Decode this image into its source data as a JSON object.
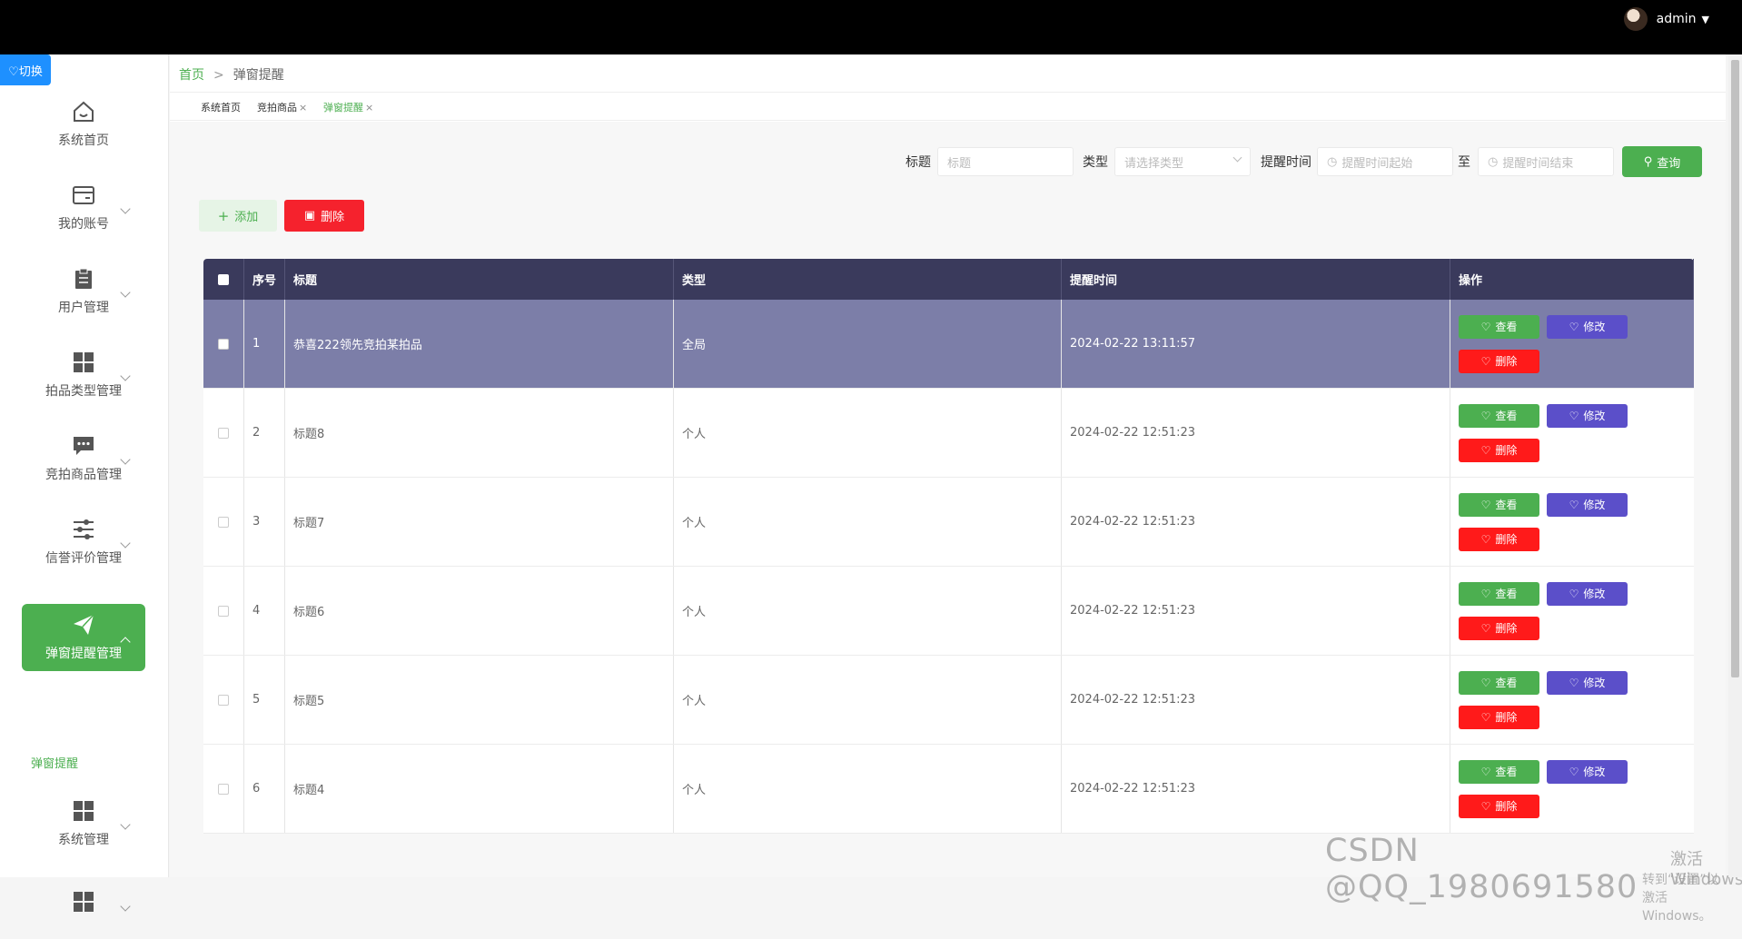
{
  "header": {
    "username": "admin"
  },
  "switch_label": "♡切换",
  "sidebar": {
    "items": [
      {
        "label": "系统首页",
        "icon": "home-icon"
      },
      {
        "label": "我的账号",
        "icon": "wallet-icon"
      },
      {
        "label": "用户管理",
        "icon": "clipboard-icon"
      },
      {
        "label": "拍品类型管理",
        "icon": "grid-icon"
      },
      {
        "label": "竞拍商品管理",
        "icon": "chat-icon"
      },
      {
        "label": "信誉评价管理",
        "icon": "sliders-icon"
      },
      {
        "label": "弹窗提醒管理",
        "icon": "send-icon"
      },
      {
        "label": "系统管理",
        "icon": "grid-icon"
      },
      {
        "label": "",
        "icon": "grid-icon"
      }
    ],
    "sub_item": "弹窗提醒"
  },
  "breadcrumb": {
    "home": "首页",
    "separator": ">",
    "current": "弹窗提醒"
  },
  "tabs": [
    {
      "label": "系统首页",
      "closable": false
    },
    {
      "label": "竞拍商品",
      "closable": true
    },
    {
      "label": "弹窗提醒",
      "closable": true
    }
  ],
  "tab_close": "×",
  "search": {
    "title_label": "标题",
    "title_placeholder": "标题",
    "type_label": "类型",
    "type_placeholder": "请选择类型",
    "time_label": "提醒时间",
    "time_start_placeholder": "提醒时间起始",
    "to_label": "至",
    "time_end_placeholder": "提醒时间结束",
    "query_label": "查询"
  },
  "toolbar": {
    "add_label": "添加",
    "delete_label": "删除"
  },
  "table": {
    "headers": [
      "序号",
      "标题",
      "类型",
      "提醒时间",
      "操作"
    ],
    "rows": [
      {
        "no": "1",
        "title": "恭喜222领先竞拍某拍品",
        "type": "全局",
        "time": "2024-02-22 13:11:57"
      },
      {
        "no": "2",
        "title": "标题8",
        "type": "个人",
        "time": "2024-02-22 12:51:23"
      },
      {
        "no": "3",
        "title": "标题7",
        "type": "个人",
        "time": "2024-02-22 12:51:23"
      },
      {
        "no": "4",
        "title": "标题6",
        "type": "个人",
        "time": "2024-02-22 12:51:23"
      },
      {
        "no": "5",
        "title": "标题5",
        "type": "个人",
        "time": "2024-02-22 12:51:23"
      },
      {
        "no": "6",
        "title": "标题4",
        "type": "个人",
        "time": "2024-02-22 12:51:23"
      }
    ],
    "ops": {
      "view": "查看",
      "edit": "修改",
      "delete": "删除"
    }
  },
  "watermark": "CSDN @QQ_1980691580",
  "windows_activation": {
    "line1": "激活 Windows",
    "line2": "转到“设置”以激活 Windows。"
  },
  "colors": {
    "accent": "#4caf50",
    "danger": "#f5222d",
    "header_bg": "#3a3a5c",
    "edit": "#5b4fc9"
  }
}
